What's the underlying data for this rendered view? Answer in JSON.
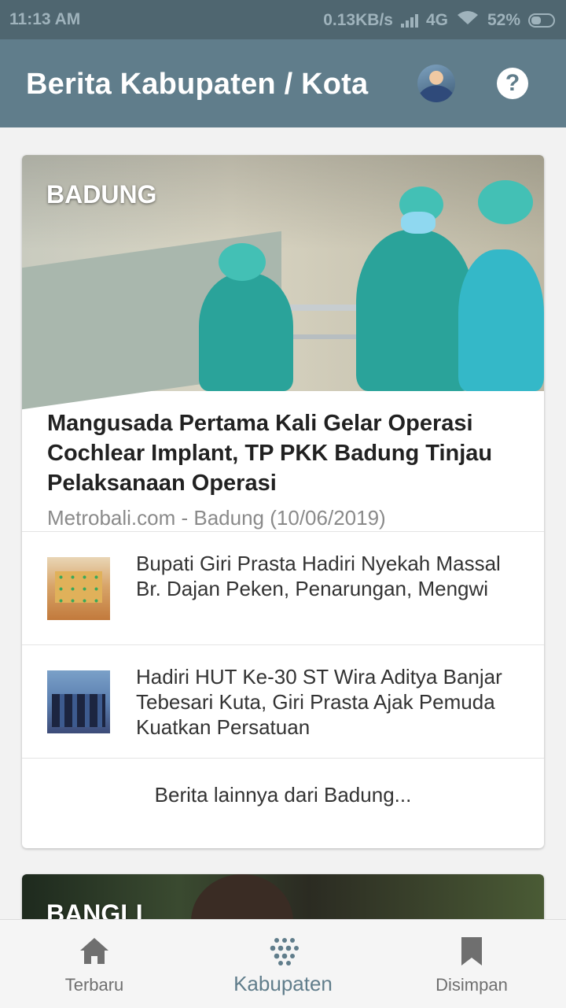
{
  "status_bar": {
    "time": "11:13 AM",
    "speed": "0.13KB/s",
    "network": "4G",
    "battery": "52%"
  },
  "app_bar": {
    "title": "Berita Kabupaten / Kota",
    "avatar_icon": "user-avatar",
    "help_icon": "help-icon",
    "help_glyph": "?"
  },
  "sections": [
    {
      "region": "BADUNG",
      "main_article": {
        "title": "Mangusada Pertama Kali Gelar Operasi Cochlear Implant, TP PKK Badung Tinjau Pelaksanaan Operasi",
        "meta": "Metrobali.com - Badung (10/06/2019)"
      },
      "items": [
        {
          "title": "Bupati Giri Prasta Hadiri Nyekah Massal Br. Dajan Peken, Penarungan, Mengwi"
        },
        {
          "title": "Hadiri HUT Ke-30 ST Wira Aditya Banjar Tebesari Kuta, Giri Prasta Ajak Pemuda Kuatkan Persatuan"
        }
      ],
      "more_link": "Berita lainnya dari Badung..."
    },
    {
      "region": "BANGLI"
    }
  ],
  "bottom_nav": [
    {
      "label": "Terbaru",
      "icon": "home-icon",
      "active": false
    },
    {
      "label": "Kabupaten",
      "icon": "grid-icon",
      "active": true
    },
    {
      "label": "Disimpan",
      "icon": "bookmark-icon",
      "active": false
    }
  ],
  "colors": {
    "status_bar": "#4f6670",
    "app_bar": "#607d8b",
    "accent": "#607d8b",
    "background": "#f2f2f2"
  }
}
